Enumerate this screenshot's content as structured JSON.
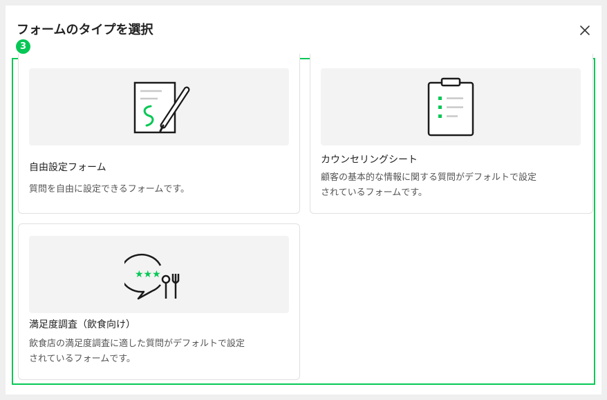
{
  "dialog": {
    "title": "フォームのタイプを選択",
    "step_number": "3"
  },
  "colors": {
    "accent": "#06c755",
    "thumb_bg": "#f3f3f3"
  },
  "cards": [
    {
      "title": "自由設定フォーム",
      "description": "質問を自由に設定できるフォームです。",
      "icon": "pen-on-paper-icon"
    },
    {
      "title": "カウンセリングシート",
      "description": "顧客の基本的な情報に関する質問がデフォルトで設定\nされているフォームです。",
      "icon": "clipboard-checklist-icon"
    },
    {
      "title": "満足度調査（飲食向け）",
      "description": "飲食店の満足度調査に適した質問がデフォルトで設定\nされているフォームです。",
      "icon": "rating-bubble-cutlery-icon"
    }
  ]
}
